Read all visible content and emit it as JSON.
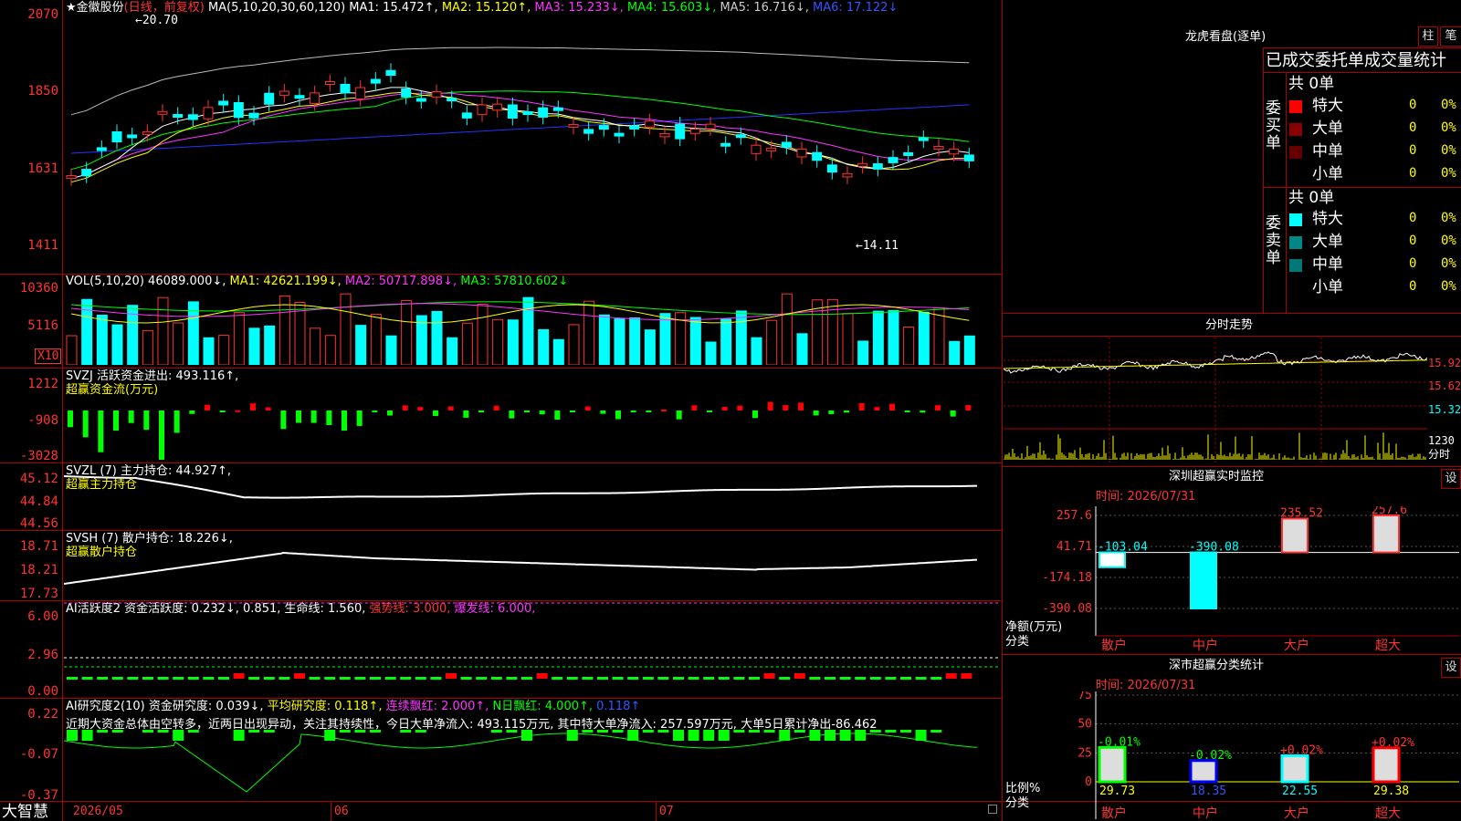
{
  "stock": {
    "star": "★",
    "name": "金徽股份",
    "period": "(日线，前复权)",
    "hi_mark": "20.70",
    "lo_mark": "14.11"
  },
  "ma_line": {
    "label": "MA(5,10,20,30,60,120)",
    "ma1": "MA1: 15.472↑,",
    "ma2": "MA2: 15.120↑,",
    "ma3": "MA3: 15.233↓,",
    "ma4": "MA4: 15.603↓,",
    "ma5": "MA5: 16.716↓,",
    "ma6": "MA6: 17.122↓"
  },
  "price_axis": [
    "2070",
    "1850",
    "1631",
    "1411"
  ],
  "vol": {
    "label": "VOL(5,10,20)",
    "val": "46089.000↓,",
    "ma1": "MA1: 42621.199↓,",
    "ma2": "MA2: 50717.898↓,",
    "ma3": "MA3: 57810.602↓",
    "axis": [
      "10360",
      "5116"
    ],
    "unit": "X10"
  },
  "svzj": {
    "label": "SVZJ  活跃资金进出: 493.116↑,",
    "sub": "超赢资金流(万元)",
    "axis": [
      "1212",
      "-908",
      "-3028"
    ]
  },
  "svzl": {
    "label": "SVZL (7) 主力持仓: 44.927↑,",
    "sub": "超赢主力持仓",
    "axis": [
      "45.12",
      "44.84",
      "44.56"
    ]
  },
  "svsh": {
    "label": "SVSH (7) 散户持仓: 18.226↓,",
    "sub": "超赢散户持仓",
    "axis": [
      "18.71",
      "18.21",
      "17.73"
    ]
  },
  "ai1": {
    "label": "AI活跃度2 资金活跃度: 0.232↓, 0.851,",
    "life": "生命线: 1.560,",
    "strong": "强势线: 3.000,",
    "burst": "爆发线: 6.000,",
    "axis": [
      "6.00",
      "2.96",
      "0.00"
    ]
  },
  "ai2": {
    "label": "AI研究度2(10) 资金研究度: 0.039↓,",
    "avg": "平均研究度: 0.118↑,",
    "cont": "连续飘红: 2.000↑,",
    "nday": "N日飘红: 4.000↑,",
    "last": "0.118↑",
    "axis": [
      "0.22",
      "-0.07",
      "-0.37"
    ],
    "comment": "近期大资金总体由空转多，近两日出现异动，关注其持续性，今日大单净流入: 493.115万元, 其中特大单净流入: 257.597万元, 大单5日累计净出-86.462"
  },
  "dates": {
    "brand": "大智慧",
    "d1": "2026/05",
    "d2": "06",
    "d3": "07"
  },
  "right": {
    "tabs": [
      "柱",
      "笔"
    ],
    "title": "龙虎看盘(逐单)",
    "table_title": "已成交委托单成交量统计",
    "buy_total": "共 0单",
    "sell_total": "共 0单",
    "buy_label": [
      "委",
      "买",
      "单"
    ],
    "sell_label": [
      "委",
      "卖",
      "单"
    ],
    "rows": [
      {
        "name": "特大",
        "n": "0",
        "p": "0%"
      },
      {
        "name": "大单",
        "n": "0",
        "p": "0%"
      },
      {
        "name": "中单",
        "n": "0",
        "p": "0%"
      },
      {
        "name": "小单",
        "n": "0",
        "p": "0%"
      }
    ],
    "buy_colors": [
      "#ff0000",
      "#880000",
      "#660000",
      "#000000"
    ],
    "sell_colors": [
      "#00ffff",
      "#008888",
      "#007777",
      "#000000"
    ],
    "intraday_title": "分时走势",
    "intraday_axis": [
      "15.92",
      "15.62",
      "15.32",
      "1230",
      "分时"
    ],
    "monitor": {
      "title": "深圳超赢实时监控",
      "setting": "设",
      "time": "时间: 2026/07/31",
      "axis": [
        "257.6",
        "41.71",
        "-174.18",
        "-390.08"
      ],
      "ylabel": "净额(万元)",
      "xlabel": "分类",
      "bars": [
        {
          "cat": "散户",
          "val": "-103.04",
          "v": -103.04
        },
        {
          "cat": "中户",
          "val": "-390.08",
          "v": -390.08
        },
        {
          "cat": "大户",
          "val": "235.52",
          "v": 235.52
        },
        {
          "cat": "超大",
          "val": "257.6",
          "v": 257.6
        }
      ]
    },
    "classify": {
      "title": "深市超赢分类统计",
      "setting": "设",
      "time": "时间: 2026/07/31",
      "axis": [
        "75",
        "50",
        "25",
        "0"
      ],
      "ylabel": "比例%",
      "xlabel": "分类",
      "bars": [
        {
          "cat": "散户",
          "pct": "-0.01%",
          "val": "29.73",
          "v": 29.73
        },
        {
          "cat": "中户",
          "pct": "-0.02%",
          "val": "18.35",
          "v": 18.35
        },
        {
          "cat": "大户",
          "pct": "+0.02%",
          "val": "22.55",
          "v": 22.55
        },
        {
          "cat": "超大",
          "pct": "+0.02%",
          "val": "29.38",
          "v": 29.38
        }
      ]
    }
  },
  "colors": {
    "up": "#ff3333",
    "down": "#00ffff",
    "ma1": "#ffffff",
    "ma2": "#ffff00",
    "ma3": "#ff33ff",
    "ma4": "#00ff00",
    "ma5": "#bbbbbb",
    "ma6": "#2233ff"
  }
}
